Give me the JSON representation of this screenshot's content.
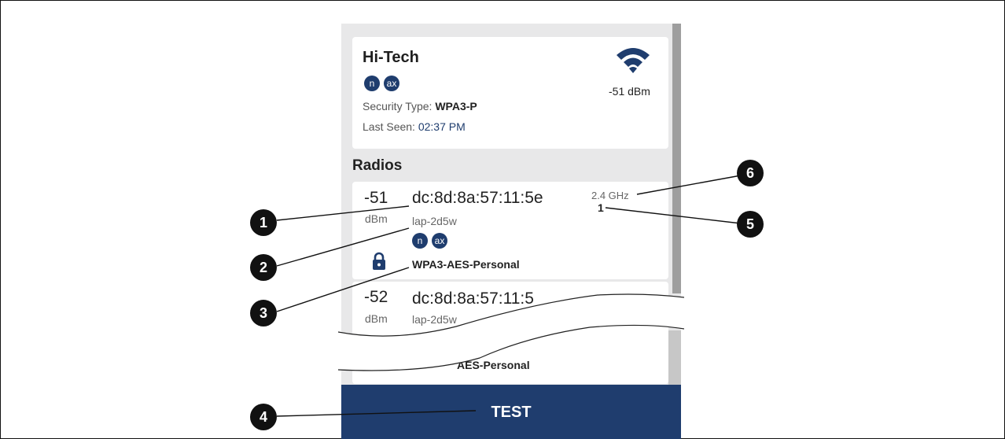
{
  "network": {
    "name": "Hi-Tech",
    "badges": [
      "n",
      "ax"
    ],
    "security_label": "Security Type: ",
    "security_value": "WPA3-P",
    "last_seen_label": "Last Seen: ",
    "last_seen_value": "02:37 PM",
    "rssi": "-51 dBm",
    "signal_icon": "wifi-signal-icon"
  },
  "section_title": "Radios",
  "radios": [
    {
      "rssi": "-51",
      "unit": "dBm",
      "mac": "dc:8d:8a:57:11:5e",
      "hostname": "lap-2d5w",
      "badges": [
        "n",
        "ax"
      ],
      "security": "WPA3-AES-Personal",
      "band": "2.4 GHz",
      "channel": "1",
      "lock_icon": "lock-icon"
    },
    {
      "rssi": "-52",
      "unit": "dBm",
      "mac": "dc:8d:8a:57:11:5",
      "hostname": "lap-2d5w",
      "security": "AES-Personal"
    }
  ],
  "action": {
    "test_label": "TEST"
  },
  "callouts": [
    "1",
    "2",
    "3",
    "4",
    "5",
    "6"
  ],
  "colors": {
    "primary": "#1f3d6e",
    "panel_bg": "#e8e8e9"
  }
}
